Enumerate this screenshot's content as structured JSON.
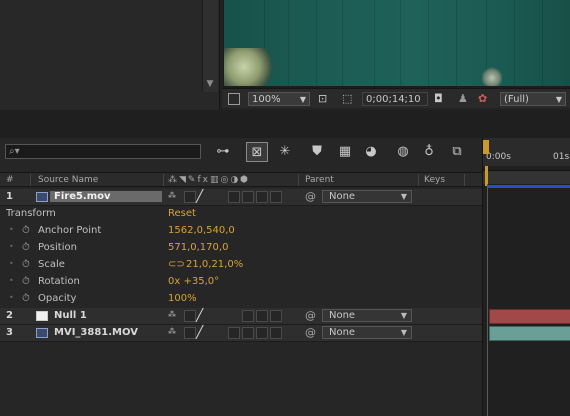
{
  "viewer": {
    "zoom_dropdown": "100%",
    "timecode": "0;00;14;10",
    "resolution_dropdown": "(Full)"
  },
  "search": {
    "placeholder": ""
  },
  "timeline": {
    "ruler_labels": [
      "0:00s",
      "01s"
    ],
    "columns": {
      "number": "#",
      "source_name": "Source Name",
      "parent": "Parent",
      "keys": "Keys"
    },
    "layers": [
      {
        "index": "1",
        "name": "Fire5.mov",
        "type": "footage",
        "parent": "None",
        "selected": true
      },
      {
        "index": "2",
        "name": "Null 1",
        "type": "null",
        "parent": "None",
        "bar_color": "#a24848"
      },
      {
        "index": "3",
        "name": "MVI_3881.MOV",
        "type": "footage",
        "parent": "None",
        "bar_color": "#6a9f98"
      }
    ],
    "transform": {
      "label": "Transform",
      "reset": "Reset",
      "properties": [
        {
          "name": "Anchor Point",
          "value": "1562,0,540,0"
        },
        {
          "name": "Position",
          "value": "571,0,170,0"
        },
        {
          "name": "Scale",
          "value": "21,0,21,0%"
        },
        {
          "name": "Rotation",
          "value": "0x +35,0°"
        },
        {
          "name": "Opacity",
          "value": "100%"
        }
      ]
    }
  },
  "colors": {
    "value_accent": "#d7a23a",
    "playhead": "#cc9a2a",
    "work_area": "#2a4ccf"
  }
}
